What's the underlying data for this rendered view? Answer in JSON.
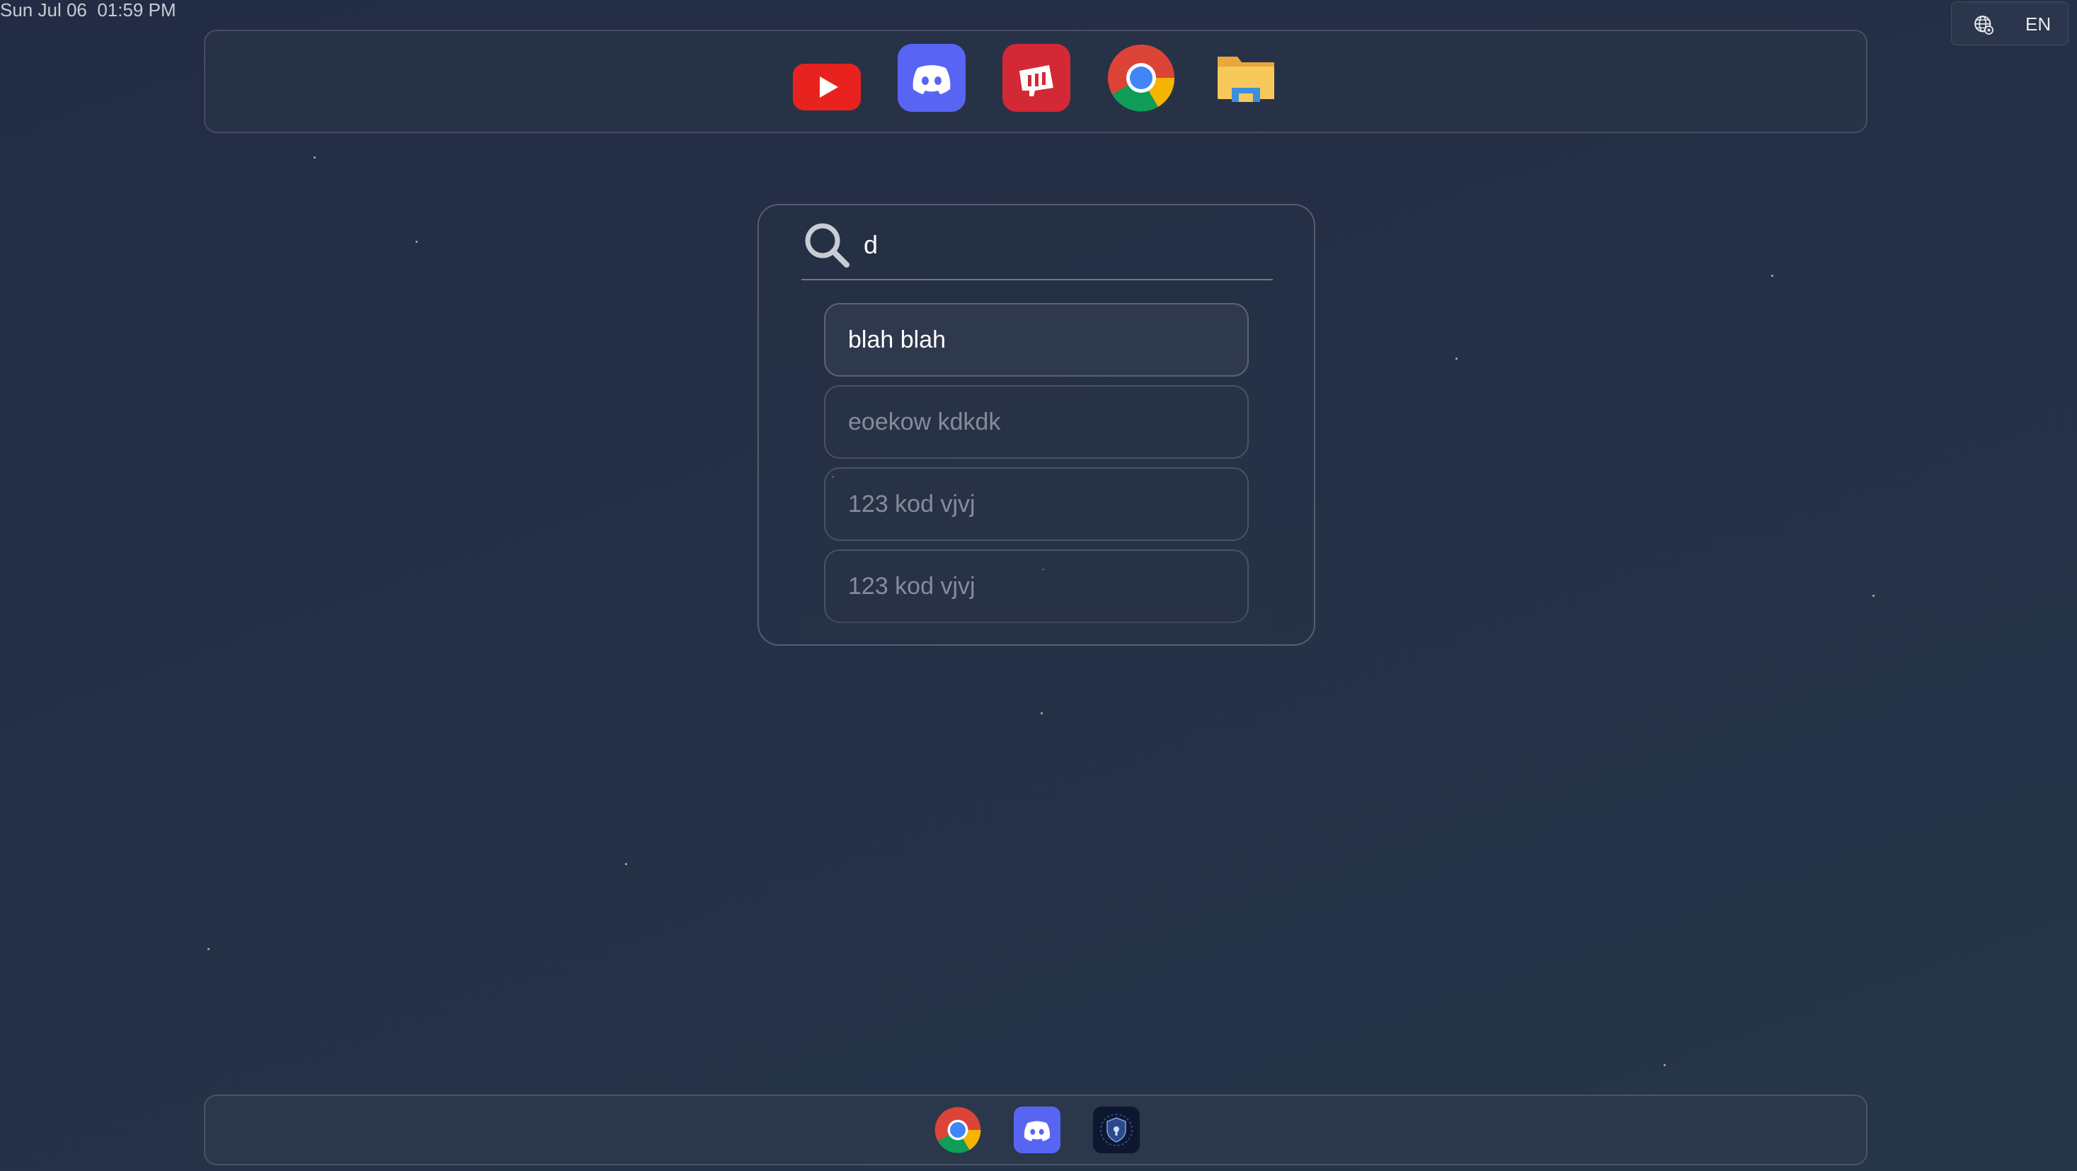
{
  "status_bar": {
    "datetime": "Sun Jul 06  01:59 PM"
  },
  "language": {
    "icon": "globe-settings-icon",
    "code": "EN"
  },
  "top_bar": {
    "apps": [
      {
        "name": "YouTube",
        "icon": "youtube-icon"
      },
      {
        "name": "Discord",
        "icon": "discord-icon"
      },
      {
        "name": "Riot Client",
        "icon": "riot-games-icon"
      },
      {
        "name": "Google Chrome",
        "icon": "chrome-icon"
      },
      {
        "name": "File Explorer",
        "icon": "file-explorer-icon"
      }
    ]
  },
  "search": {
    "query": "d",
    "results": [
      {
        "label": "blah blah",
        "active": true
      },
      {
        "label": "eoekow kdkdk",
        "active": false
      },
      {
        "label": "123 kod vjvj",
        "active": false
      },
      {
        "label": "123 kod vjvj",
        "active": false
      }
    ]
  },
  "dock": {
    "apps": [
      {
        "name": "Google Chrome",
        "icon": "chrome-icon"
      },
      {
        "name": "Discord",
        "icon": "discord-icon"
      },
      {
        "name": "Security app",
        "icon": "shield-app-icon"
      }
    ]
  },
  "colors": {
    "youtube": "#E8231F",
    "discord": "#5865F2",
    "riot": "#D32936",
    "background": "#243047"
  }
}
